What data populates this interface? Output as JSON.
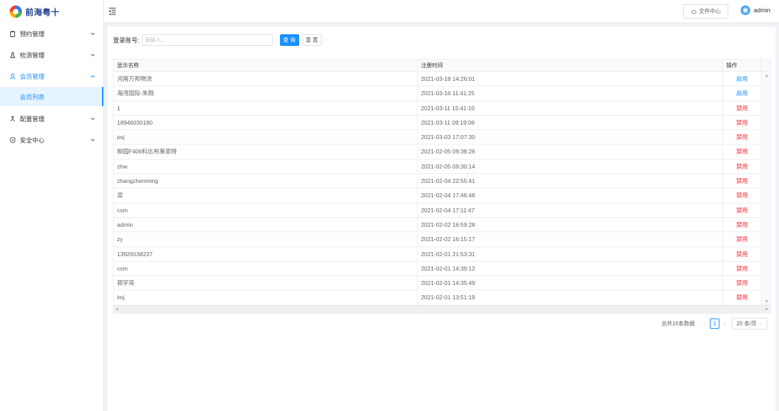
{
  "app": {
    "logo_text": "前海粤十"
  },
  "sidebar": {
    "items": [
      {
        "label": "预约管理",
        "icon": "clipboard-icon",
        "expanded": false
      },
      {
        "label": "检测管理",
        "icon": "flask-icon",
        "expanded": false
      },
      {
        "label": "会员管理",
        "icon": "user-icon",
        "expanded": true,
        "children": [
          {
            "label": "会员列表",
            "active": true
          }
        ]
      },
      {
        "label": "配置管理",
        "icon": "network-icon",
        "expanded": false
      },
      {
        "label": "安全中心",
        "icon": "shield-icon",
        "expanded": false
      }
    ]
  },
  "header": {
    "file_center_label": "文件中心",
    "username": "admin"
  },
  "search": {
    "label": "登录账号:",
    "placeholder": "请输入...",
    "value": "",
    "query_label": "查 询",
    "reset_label": "重 置"
  },
  "table": {
    "columns": [
      "显示名称",
      "注册时间",
      "操作"
    ],
    "rows": [
      {
        "name": "河南万邦物流",
        "time": "2021-03-18 14:26:01",
        "op": "启用",
        "op_type": "enable"
      },
      {
        "name": "海湾国际-朱刚",
        "time": "2021-03-16 11:41:25",
        "op": "启用",
        "op_type": "enable"
      },
      {
        "name": "1",
        "time": "2021-03-11 15:41:10",
        "op": "禁用",
        "op_type": "disable"
      },
      {
        "name": "18946030180",
        "time": "2021-03-11 09:19:06",
        "op": "禁用",
        "op_type": "disable"
      },
      {
        "name": "psj",
        "time": "2021-03-03 17:07:30",
        "op": "禁用",
        "op_type": "disable"
      },
      {
        "name": "柳园F406科比布莱恩特",
        "time": "2021-02-05 09:38:26",
        "op": "禁用",
        "op_type": "disable"
      },
      {
        "name": "zhw",
        "time": "2021-02-05 09:30:14",
        "op": "禁用",
        "op_type": "disable"
      },
      {
        "name": "zhangzhenming",
        "time": "2021-02-04 22:55:41",
        "op": "禁用",
        "op_type": "disable"
      },
      {
        "name": "梁",
        "time": "2021-02-04 17:46:48",
        "op": "禁用",
        "op_type": "disable"
      },
      {
        "name": "csm",
        "time": "2021-02-04 17:11:47",
        "op": "禁用",
        "op_type": "disable"
      },
      {
        "name": "admin",
        "time": "2021-02-02 16:59:28",
        "op": "禁用",
        "op_type": "disable"
      },
      {
        "name": "zy",
        "time": "2021-02-02 16:15:17",
        "op": "禁用",
        "op_type": "disable"
      },
      {
        "name": "13926538237",
        "time": "2021-02-01 21:53:31",
        "op": "禁用",
        "op_type": "disable"
      },
      {
        "name": "csm",
        "time": "2021-02-01 14:39:12",
        "op": "禁用",
        "op_type": "disable"
      },
      {
        "name": "郭宇亮",
        "time": "2021-02-01 14:35:49",
        "op": "禁用",
        "op_type": "disable"
      },
      {
        "name": "lmj",
        "time": "2021-02-01 13:51:19",
        "op": "禁用",
        "op_type": "disable"
      }
    ]
  },
  "pagination": {
    "total_text": "总共16条数据",
    "current_page": "1",
    "page_size": "20 条/页"
  },
  "colors": {
    "primary": "#1890ff",
    "danger": "#f5222d",
    "enable": "#1890ff"
  }
}
